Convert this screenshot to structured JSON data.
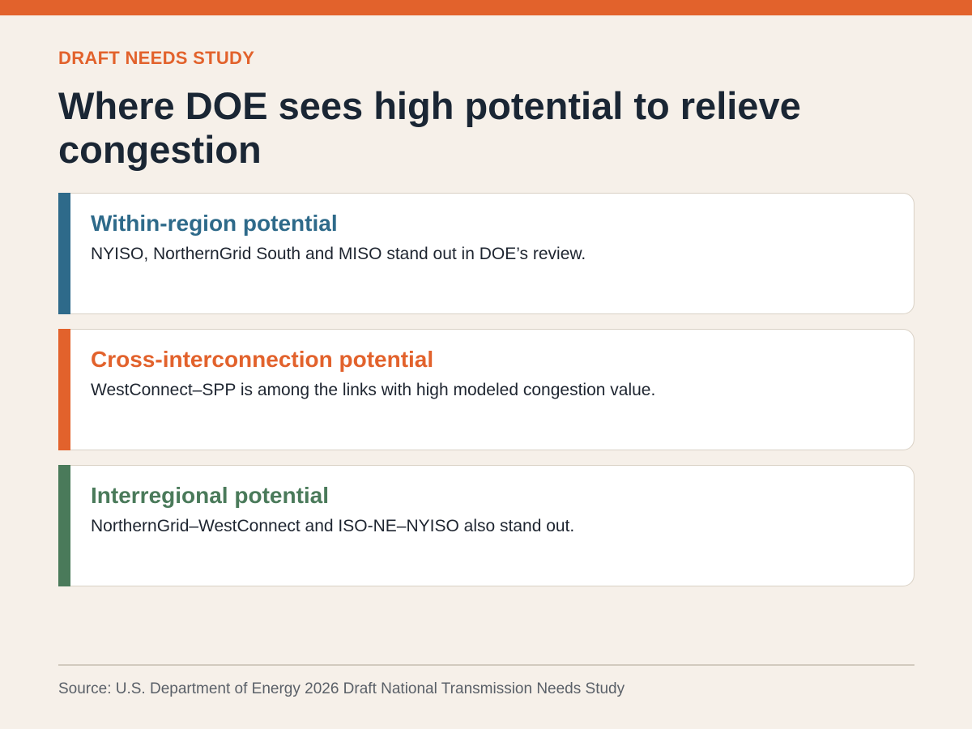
{
  "header": {
    "eyebrow": "DRAFT NEEDS STUDY",
    "title": "Where DOE sees high potential to relieve congestion",
    "accent_color": "#E2622C"
  },
  "cards": [
    {
      "heading": "Within-region potential",
      "body": "NYISO, NorthernGrid South and MISO stand out in DOE’s review.",
      "color": "#2E6A8A"
    },
    {
      "heading": "Cross-interconnection potential",
      "body": "WestConnect–SPP is among the links with high modeled congestion value.",
      "color": "#E2622C"
    },
    {
      "heading": "Interregional potential",
      "body": "NorthernGrid–WestConnect and ISO-NE–NYISO also stand out.",
      "color": "#4A7A5A"
    }
  ],
  "footer": {
    "source": "Source: U.S. Department of Energy 2026 Draft National Transmission Needs Study"
  }
}
